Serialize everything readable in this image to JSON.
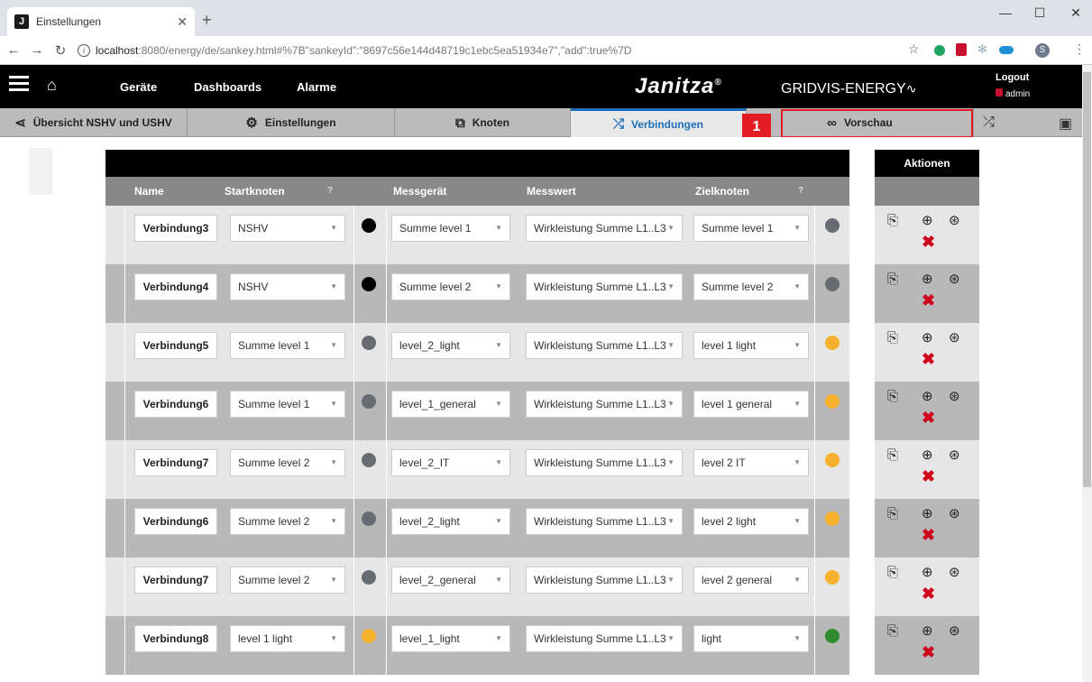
{
  "browser": {
    "tab_title": "Einstellungen",
    "favicon_letter": "J",
    "url_host": "localhost",
    "url_rest": ":8080/energy/de/sankey.html#%7B\"sankeyId\":\"8697c56e144d48719c1ebc5ea51934e7\",\"add\":true%7D",
    "profile_letter": "S"
  },
  "header": {
    "nav": [
      "Geräte",
      "Dashboards",
      "Alarme"
    ],
    "brand": "Janitza",
    "brand_mark": "®",
    "brand_sub": "GRIDVIS-ENERGY",
    "logout": "Logout",
    "user": "admin"
  },
  "tabs": [
    {
      "label": "Übersicht NSHV und USHV",
      "icon": "share-icon"
    },
    {
      "label": "Einstellungen",
      "icon": "gears-icon"
    },
    {
      "label": "Knoten",
      "icon": "nodes-icon"
    },
    {
      "label": "Verbindungen",
      "icon": "shuffle-icon",
      "active": true
    },
    {
      "label": "Vorschau",
      "icon": "glasses-icon"
    }
  ],
  "step_badge": "1",
  "table": {
    "headers": {
      "name": "Name",
      "start": "Startknoten",
      "device": "Messgerät",
      "value": "Messwert",
      "target": "Zielknoten"
    },
    "actions_header": "Aktionen",
    "rows": [
      {
        "name": "Verbindung3",
        "start": "NSHV",
        "start_color": "#000000",
        "device": "Summe level 1",
        "value": "Wirkleistung Summe L1..L3",
        "target": "Summe level 1",
        "target_color": "#666c72"
      },
      {
        "name": "Verbindung4",
        "start": "NSHV",
        "start_color": "#000000",
        "device": "Summe level 2",
        "value": "Wirkleistung Summe L1..L3",
        "target": "Summe level 2",
        "target_color": "#666c72"
      },
      {
        "name": "Verbindung5",
        "start": "Summe level 1",
        "start_color": "#666c72",
        "device": "level_2_light",
        "value": "Wirkleistung Summe L1..L3",
        "target": "level 1 light",
        "target_color": "#f5b02e"
      },
      {
        "name": "Verbindung6",
        "start": "Summe level 1",
        "start_color": "#666c72",
        "device": "level_1_general",
        "value": "Wirkleistung Summe L1..L3",
        "target": "level 1 general",
        "target_color": "#f5b02e"
      },
      {
        "name": "Verbindung7",
        "start": "Summe level 2",
        "start_color": "#666c72",
        "device": "level_2_IT",
        "value": "Wirkleistung Summe L1..L3",
        "target": "level 2 IT",
        "target_color": "#f5b02e"
      },
      {
        "name": "Verbindung6",
        "start": "Summe level 2",
        "start_color": "#666c72",
        "device": "level_2_light",
        "value": "Wirkleistung Summe L1..L3",
        "target": "level 2 light",
        "target_color": "#f5b02e"
      },
      {
        "name": "Verbindung7",
        "start": "Summe level 2",
        "start_color": "#666c72",
        "device": "level_2_general",
        "value": "Wirkleistung Summe L1..L3",
        "target": "level 2 general",
        "target_color": "#f5b02e"
      },
      {
        "name": "Verbindung8",
        "start": "level 1 light",
        "start_color": "#f5b02e",
        "device": "level_1_light",
        "value": "Wirkleistung Summe L1..L3",
        "target": "light",
        "target_color": "#2e8b2e"
      }
    ]
  }
}
